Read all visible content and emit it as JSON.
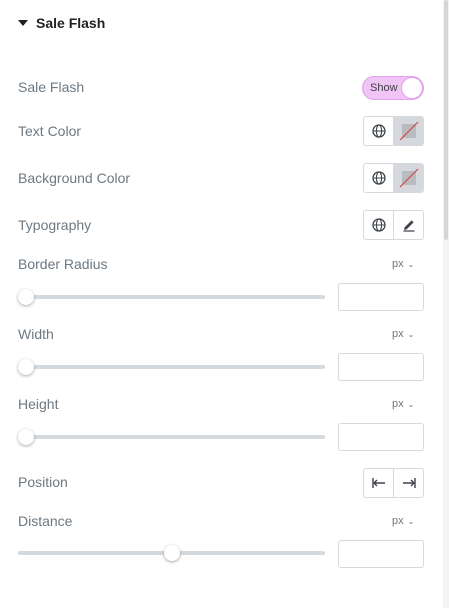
{
  "section": {
    "title": "Sale Flash"
  },
  "controls": {
    "sale_flash": {
      "label": "Sale Flash",
      "toggle_text": "Show",
      "enabled": true
    },
    "text_color": {
      "label": "Text Color"
    },
    "background_color": {
      "label": "Background Color"
    },
    "typography": {
      "label": "Typography"
    },
    "border_radius": {
      "label": "Border Radius",
      "unit": "px",
      "value": "",
      "slider_fraction": 0
    },
    "width": {
      "label": "Width",
      "unit": "px",
      "value": "",
      "slider_fraction": 0
    },
    "height": {
      "label": "Height",
      "unit": "px",
      "value": "",
      "slider_fraction": 0
    },
    "position": {
      "label": "Position"
    },
    "distance": {
      "label": "Distance",
      "unit": "px",
      "value": "",
      "slider_fraction": 0.5
    }
  },
  "icons": {
    "globe": "globe-icon",
    "color_swatch": "color-swatch-icon",
    "pencil": "pencil-icon",
    "align_left": "align-left-icon",
    "align_right": "align-right-icon",
    "chevron": "chevron-down-icon"
  },
  "colors": {
    "toggle_bg": "#f0c4f5",
    "label": "#6d7882",
    "heading": "#1f2124",
    "swatch_strike": "#d04a4a"
  }
}
